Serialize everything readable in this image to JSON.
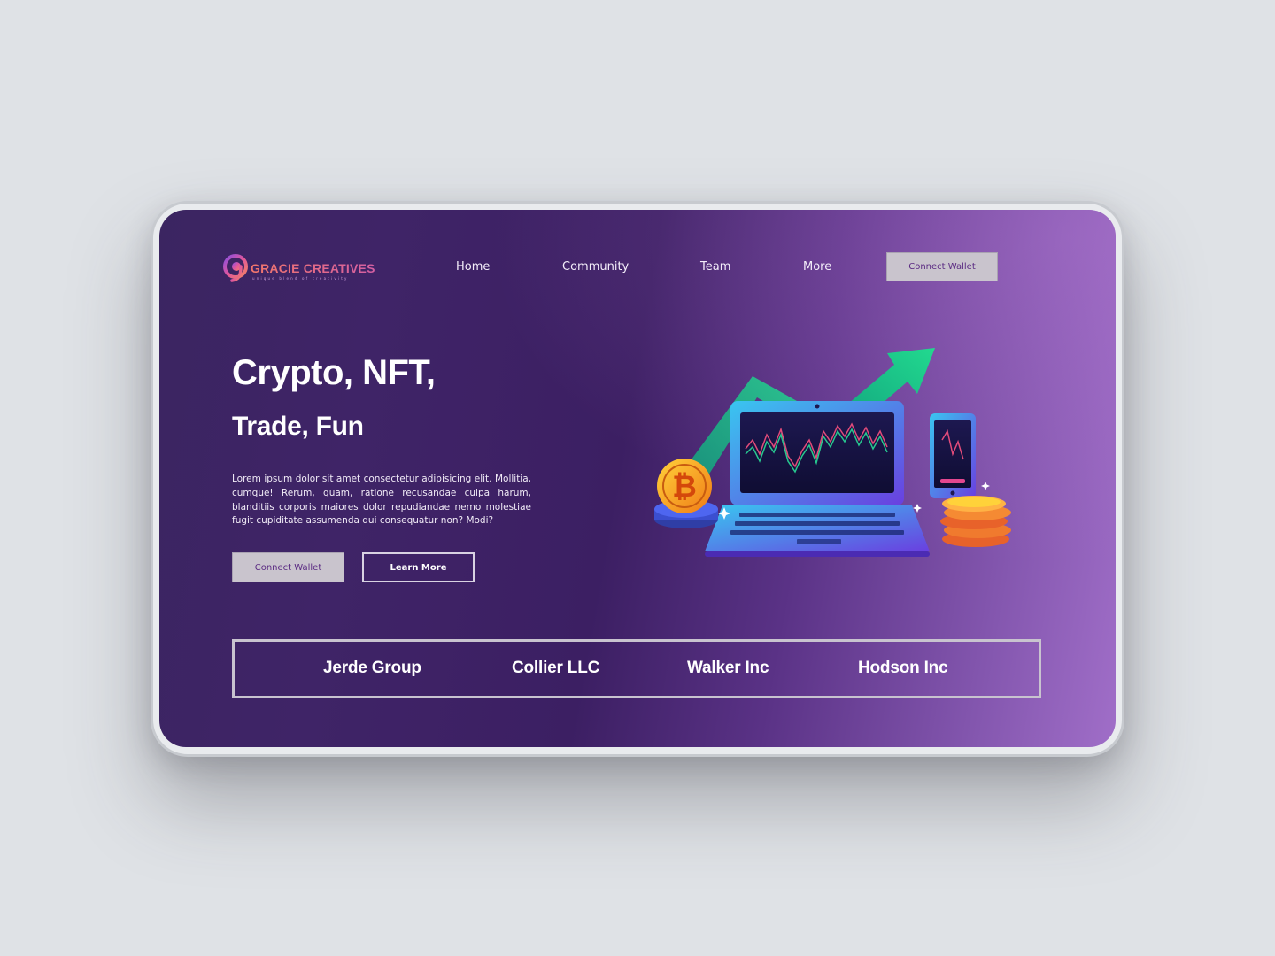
{
  "brand": {
    "name": "GRACIE CREATIVES",
    "tagline": "unique blend of creativity",
    "logo_letter": "g"
  },
  "nav": {
    "items": [
      "Home",
      "Community",
      "Team",
      "More"
    ],
    "cta": "Connect Wallet"
  },
  "hero": {
    "title_line1": "Crypto, NFT,",
    "title_line2": "Trade, Fun",
    "body": "Lorem ipsum dolor sit amet consectetur adipisicing elit. Mollitia, cumque! Rerum, quam, ratione recusandae culpa harum, blanditiis corporis maiores dolor repudiandae nemo molestiae fugit cupiditate assumenda qui consequatur non? Modi?",
    "primary_button": "Connect Wallet",
    "secondary_button": "Learn More"
  },
  "illustration": {
    "coin_symbol": "₿",
    "icons": [
      "laptop-icon",
      "phone-icon",
      "bitcoin-coin-icon",
      "coin-stack-icon",
      "up-arrow-icon"
    ]
  },
  "partners": [
    "Jerde Group",
    "Collier LLC",
    "Walker Inc",
    "Hodson Inc"
  ],
  "colors": {
    "page_background": "#dfe2e6",
    "gradient_dark": "#3c1f63",
    "gradient_light": "#a06ec8",
    "button_fill": "#c9c4cd",
    "button_text": "#5a2a82",
    "accent_green": "#19c98a",
    "logo_gradient": [
      "#f2766b",
      "#d45fa3"
    ]
  }
}
